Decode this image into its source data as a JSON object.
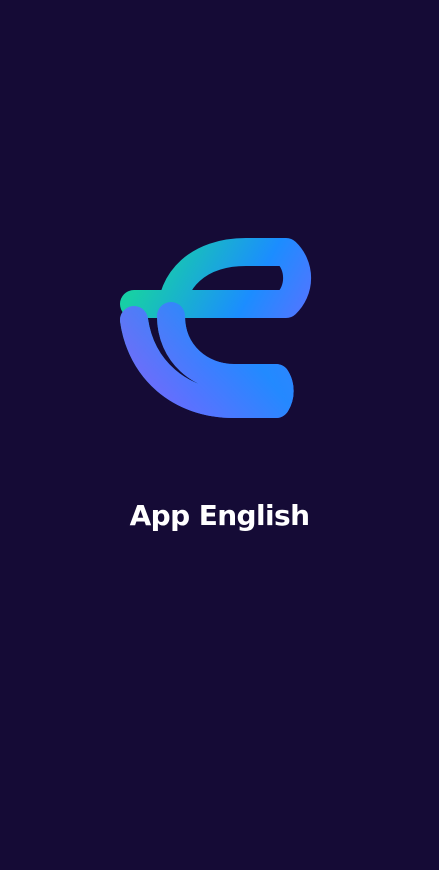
{
  "screen": {
    "name": "splash",
    "background": "#150b36"
  },
  "logo": {
    "icon": "app-english-logo-icon",
    "gradient": [
      "#17cfa6",
      "#1b8dff",
      "#7b63ff"
    ]
  },
  "app": {
    "title": "App English",
    "title_color": "#ffffff"
  }
}
